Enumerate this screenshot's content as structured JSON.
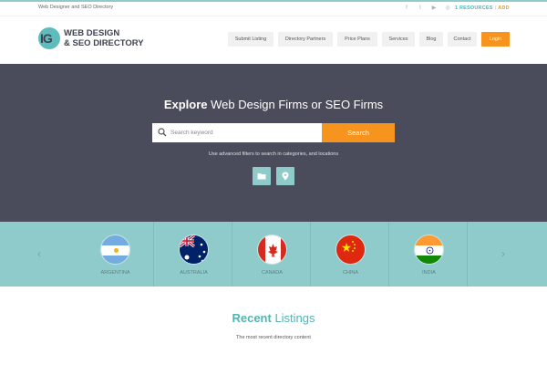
{
  "topbar": {
    "tagline": "Web Designer and SEO Directory",
    "social_icons": [
      "facebook-icon",
      "twitter-icon",
      "youtube-icon",
      "instagram-icon"
    ],
    "resources": "1 RESOURCES",
    "add": "ADD"
  },
  "logo": {
    "mark": "IG",
    "line1": "WEB DESIGN",
    "line2": "& SEO DIRECTORY"
  },
  "nav": {
    "items": [
      "Submit Listing",
      "Directory Partners",
      "Price Plans",
      "Services",
      "Blog",
      "Contact"
    ],
    "login": "Login"
  },
  "hero": {
    "title_bold": "Explore",
    "title_rest": " Web Design Firms or SEO Firms",
    "search_placeholder": "Search keyword",
    "search_button": "Search",
    "help_text": "Use advanced filters to search in categories, and locations",
    "filter_icons": [
      "folder-icon",
      "location-pin-icon"
    ]
  },
  "countries": [
    {
      "name": "ARGENTINA"
    },
    {
      "name": "AUSTRALIA"
    },
    {
      "name": "CANADA"
    },
    {
      "name": "CHINA"
    },
    {
      "name": "INDIA"
    }
  ],
  "recent": {
    "title_bold": "Recent",
    "title_rest": " Listings",
    "subtitle": "The most recent directory content"
  },
  "colors": {
    "accent_teal": "#8fcbcb",
    "accent_orange": "#f7941d",
    "hero_bg": "#4a4c5b"
  }
}
